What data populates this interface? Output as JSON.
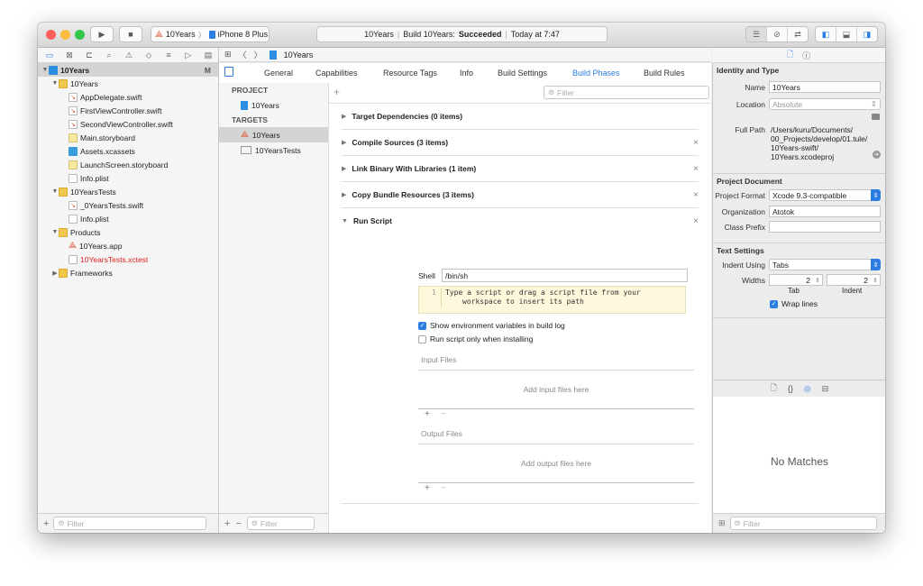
{
  "window": {
    "scheme_app": "10Years",
    "scheme_device": "iPhone 8 Plus",
    "status_project": "10Years",
    "status_build_prefix": "Build 10Years:",
    "status_build_result": "Succeeded",
    "status_time": "Today at 7:47",
    "colors": {
      "close": "#fc605c",
      "minimize": "#fdbc40",
      "zoom": "#34c84a",
      "accent": "#2b7de1"
    }
  },
  "navigator": {
    "tabs": [
      "folder-icon",
      "source-control-icon",
      "hierarchy-icon",
      "search-icon",
      "warning-icon",
      "test-icon",
      "debug-icon",
      "breakpoint-icon",
      "report-icon"
    ],
    "items": [
      {
        "label": "10Years",
        "badge": "M",
        "icon": "project-icon",
        "indent": 0,
        "disclosure": "▼",
        "selected": true
      },
      {
        "label": "10Years",
        "icon": "folder-icon",
        "indent": 1,
        "disclosure": "▼"
      },
      {
        "label": "AppDelegate.swift",
        "icon": "swift-file-icon",
        "indent": 2
      },
      {
        "label": "FirstViewController.swift",
        "icon": "swift-file-icon",
        "indent": 2
      },
      {
        "label": "SecondViewController.swift",
        "icon": "swift-file-icon",
        "indent": 2
      },
      {
        "label": "Main.storyboard",
        "icon": "storyboard-icon",
        "indent": 2
      },
      {
        "label": "Assets.xcassets",
        "icon": "assets-icon",
        "indent": 2
      },
      {
        "label": "LaunchScreen.storyboard",
        "icon": "storyboard-icon",
        "indent": 2
      },
      {
        "label": "Info.plist",
        "icon": "plist-icon",
        "indent": 2
      },
      {
        "label": "10YearsTests",
        "icon": "folder-icon",
        "indent": 1,
        "disclosure": "▼"
      },
      {
        "label": "_0YearsTests.swift",
        "icon": "swift-file-icon",
        "indent": 2
      },
      {
        "label": "Info.plist",
        "icon": "plist-icon",
        "indent": 2
      },
      {
        "label": "Products",
        "icon": "folder-icon",
        "indent": 1,
        "disclosure": "▼"
      },
      {
        "label": "10Years.app",
        "icon": "app-icon",
        "indent": 2
      },
      {
        "label": "10YearsTests.xctest",
        "icon": "xctest-icon",
        "indent": 2,
        "color": "#e02020"
      },
      {
        "label": "Frameworks",
        "icon": "folder-icon",
        "indent": 1,
        "disclosure": "▶"
      }
    ],
    "filter_placeholder": "Filter"
  },
  "jumpbar": {
    "crumb": "10Years"
  },
  "editor": {
    "tabs": [
      "General",
      "Capabilities",
      "Resource Tags",
      "Info",
      "Build Settings",
      "Build Phases",
      "Build Rules"
    ],
    "active_tab": "Build Phases",
    "project_header": "PROJECT",
    "project_name": "10Years",
    "targets_header": "TARGETS",
    "targets": [
      "10Years",
      "10YearsTests"
    ],
    "target_filter_placeholder": "Filter",
    "phase_filter_placeholder": "Filter",
    "phases": [
      {
        "title": "Target Dependencies (0 items)",
        "removable": false
      },
      {
        "title": "Compile Sources (3 items)",
        "removable": true
      },
      {
        "title": "Link Binary With Libraries (1 item)",
        "removable": true
      },
      {
        "title": "Copy Bundle Resources (3 items)",
        "removable": true
      },
      {
        "title": "Run Script",
        "removable": true,
        "expanded": true
      }
    ],
    "run_script": {
      "shell_label": "Shell",
      "shell_value": "/bin/sh",
      "line_number": "1",
      "script_line1": "Type a script or drag a script file from your",
      "script_line2": "workspace to insert its path",
      "show_env_label": "Show environment variables in build log",
      "show_env_checked": true,
      "install_only_label": "Run script only when installing",
      "install_only_checked": false,
      "input_files_header": "Input Files",
      "input_files_placeholder": "Add input files here",
      "output_files_header": "Output Files",
      "output_files_placeholder": "Add output files here"
    }
  },
  "inspector": {
    "identity_header": "Identity and Type",
    "name_label": "Name",
    "name_value": "10Years",
    "location_label": "Location",
    "location_value": "Absolute",
    "full_path_label": "Full Path",
    "full_path_lines": [
      "/Users/kuru/Documents/",
      "00_Projects/develop/01.tule/",
      "10Years-swift/",
      "10Years.xcodeproj"
    ],
    "project_doc_header": "Project Document",
    "project_format_label": "Project Format",
    "project_format_value": "Xcode 9.3-compatible",
    "organization_label": "Organization",
    "organization_value": "Atotok",
    "class_prefix_label": "Class Prefix",
    "class_prefix_value": "",
    "text_settings_header": "Text Settings",
    "indent_using_label": "Indent Using",
    "indent_using_value": "Tabs",
    "widths_label": "Widths",
    "tab_width": "2",
    "indent_width": "2",
    "tab_caption": "Tab",
    "indent_caption": "Indent",
    "wrap_lines_label": "Wrap lines",
    "wrap_lines_checked": true,
    "library_no_matches": "No Matches",
    "library_filter_placeholder": "Filter"
  }
}
